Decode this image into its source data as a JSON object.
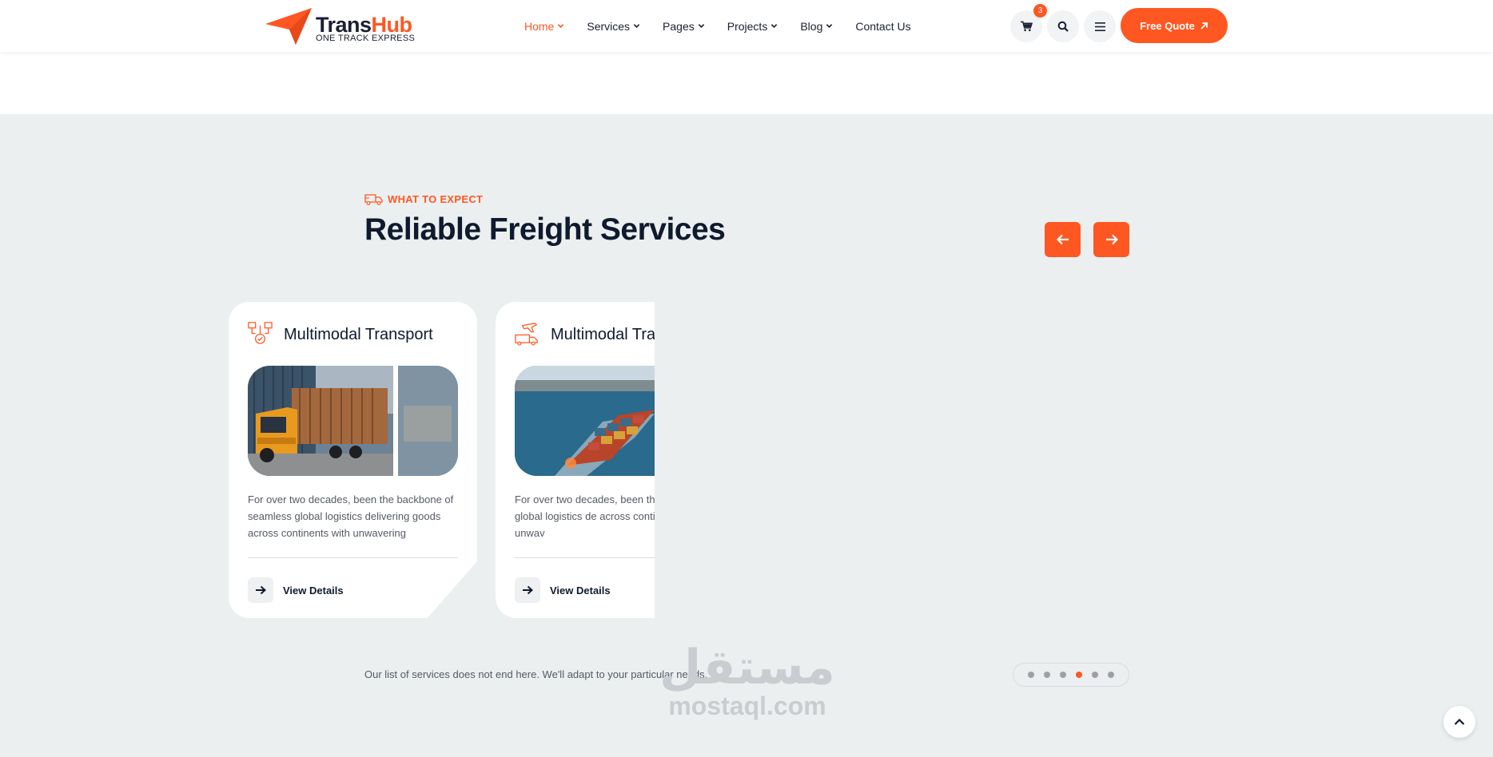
{
  "brand": {
    "name_part1": "Trans",
    "name_part2": "Hub",
    "tagline": "ONE TRACK EXPRESS",
    "accent_color": "#ff5722"
  },
  "nav": {
    "items": [
      {
        "label": "Home",
        "dropdown": true,
        "active": true
      },
      {
        "label": "Services",
        "dropdown": true,
        "active": false
      },
      {
        "label": "Pages",
        "dropdown": true,
        "active": false
      },
      {
        "label": "Projects",
        "dropdown": true,
        "active": false
      },
      {
        "label": "Blog",
        "dropdown": true,
        "active": false
      },
      {
        "label": "Contact Us",
        "dropdown": false,
        "active": false
      }
    ]
  },
  "header_actions": {
    "cart_count": "3",
    "cart_icon": "cart-icon",
    "search_icon": "search-icon",
    "menu_icon": "hamburger-icon",
    "quote_label": "Free Quote"
  },
  "section": {
    "eyebrow": "WHAT TO EXPECT",
    "title": "Reliable Freight Services",
    "bottom_note": "Our list of services does not end here. We'll adapt to your particular needs.",
    "background": "#ebeff0"
  },
  "cards": [
    {
      "title": "Multimodal Transport",
      "description": "For over two decades, been the backbone of seamless global logistics delivering goods across continents with unwavering",
      "link_label": "View Details",
      "icon": "logistics-network-icon",
      "image": "orange-truck-with-container"
    },
    {
      "title": "Multimodal Tra",
      "description": "For over two decades, been th of seamless global logistics de across continents with unwav",
      "link_label": "View Details",
      "icon": "plane-truck-icon",
      "image": "container-ship-at-sea"
    }
  ],
  "pagination": {
    "count": 6,
    "active_index": 3
  },
  "watermark": {
    "arabic": "مستقل",
    "latin": "mostaql.com"
  }
}
